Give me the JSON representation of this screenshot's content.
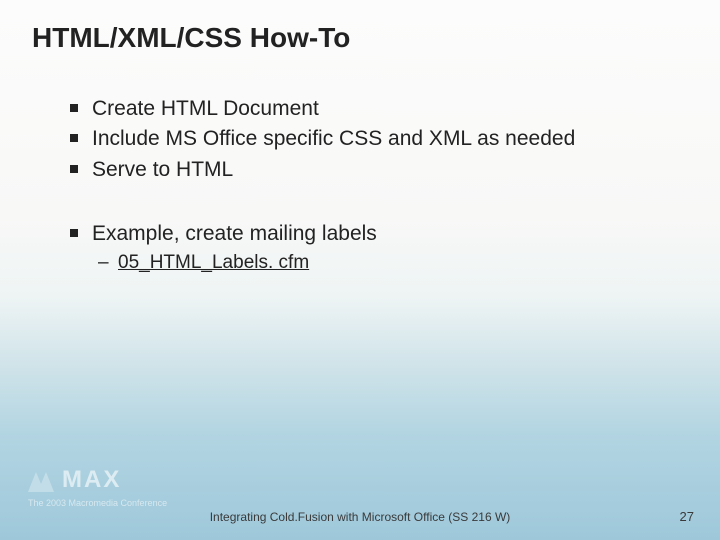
{
  "title": "HTML/XML/CSS How-To",
  "bullets_group1": [
    "Create HTML Document",
    "Include MS Office specific CSS and XML as needed",
    "Serve to HTML"
  ],
  "bullets_group2": [
    "Example, create mailing labels"
  ],
  "sub_items": [
    "05_HTML_Labels. cfm"
  ],
  "logo_main": "MAX",
  "logo_sub": "The 2003 Macromedia Conference",
  "footer_center": "Integrating Cold.Fusion with Microsoft Office (SS 216 W)",
  "page_number": "27"
}
